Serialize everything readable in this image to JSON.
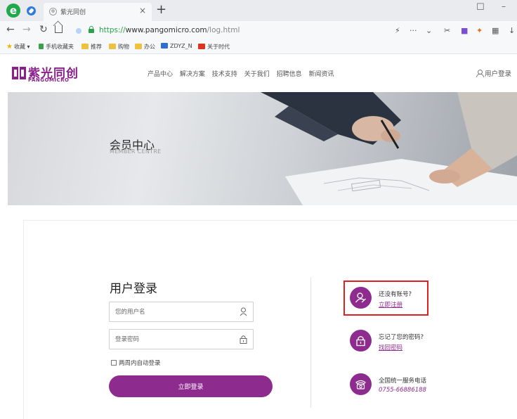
{
  "browser": {
    "tab_title": "紫光同创",
    "tab_close": "×",
    "new_tab": "+",
    "url_scheme": "https://",
    "url_host": "www.pangomicro.com",
    "url_path": "/log.html",
    "icons": [
      "browser-logo-icon",
      "compass-icon",
      "back-icon",
      "forward-icon",
      "reload-icon",
      "home-icon",
      "lock-icon",
      "lightning-icon",
      "more-icon",
      "chevron-down-icon",
      "scissors-icon",
      "extension-icon",
      "download-icon"
    ]
  },
  "bookmarks": [
    {
      "label": "收藏",
      "color": "#f0b400"
    },
    {
      "label": "手机收藏夹",
      "color": "#3aa04a"
    },
    {
      "label": "推荐",
      "color": "#f0c040"
    },
    {
      "label": "购物",
      "color": "#f0c040"
    },
    {
      "label": "办公",
      "color": "#f0c040"
    },
    {
      "label": "ZDYZ_N",
      "color": "#2e6fd6"
    },
    {
      "label": "关于时代",
      "color": "#e03020"
    }
  ],
  "site": {
    "logo_cn": "紫光同创",
    "logo_en": "PANGOMICRO",
    "brand_color": "#8e2b8f",
    "nav": [
      "产品中心",
      "解决方案",
      "技术支持",
      "关于我们",
      "招聘信息",
      "新闻资讯"
    ],
    "user_login": "用户登录"
  },
  "banner": {
    "title": "会员中心",
    "subtitle": "MEMBER CENTRE"
  },
  "login": {
    "title": "用户登录",
    "username_placeholder": "您的用户名",
    "password_placeholder": "登录密码",
    "remember_label": "两周内自动登录",
    "submit_label": "立即登录"
  },
  "side": {
    "register_prompt": "还没有账号?",
    "register_link": "立即注册",
    "forgot_prompt": "忘记了您的密码?",
    "forgot_link": "找回密码",
    "hotline_label": "全国统一服务电话",
    "hotline_number": "0755-66886188"
  }
}
